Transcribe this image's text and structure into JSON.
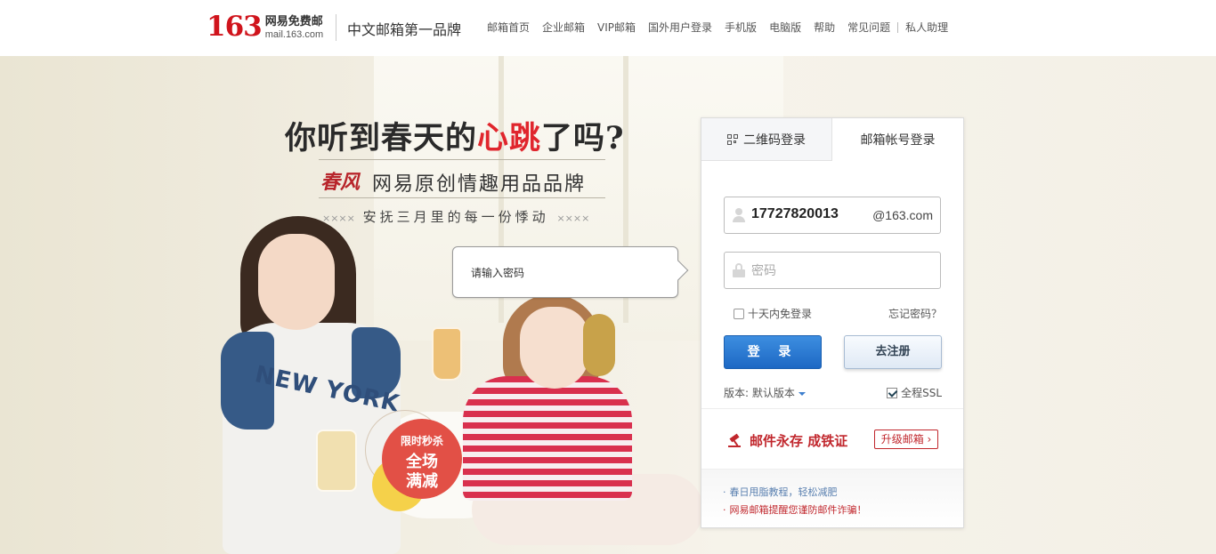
{
  "header": {
    "logo_number": "163",
    "logo_cn": "网易免费邮",
    "logo_en": "mail.163.com",
    "slogan": "中文邮箱第一品牌",
    "nav": [
      "邮箱首页",
      "企业邮箱",
      "VIP邮箱",
      "国外用户登录",
      "手机版",
      "电脑版",
      "帮助",
      "常见问题",
      "私人助理"
    ]
  },
  "hero": {
    "headline_pre": "你听到春天的",
    "headline_red": "心跳",
    "headline_post": "了吗?",
    "brand_logo": "春风",
    "brand_text": "网易原创情趣用品品牌",
    "subline": "安抚三月里的每一份悸动",
    "subline_deco": "××××",
    "shirt_print": "NEW YORK",
    "promo_small": "限时秒杀",
    "promo_line1": "全场",
    "promo_line2": "满减",
    "bubble_text": "请输入密码"
  },
  "login": {
    "tab_qr": "二维码登录",
    "tab_account": "邮箱帐号登录",
    "username_value": "17727820013",
    "domain": "@163.com",
    "password_placeholder": "密码",
    "remember_label": "十天内免登录",
    "forgot_label": "忘记密码？",
    "login_button": "登 录",
    "register_button": "去注册",
    "version_label": "版本: 默认版本",
    "ssl_label": "全程SSL",
    "promo_text": "邮件永存 成铁证",
    "upgrade_label": "升级邮箱 ›",
    "tip1": "春日甩脂教程，轻松减肥",
    "tip2": "网易邮箱提醒您谨防邮件诈骗！"
  },
  "colors": {
    "brand_red": "#d0141c",
    "accent_red": "#e0262d",
    "button_blue": "#1d68c4"
  }
}
